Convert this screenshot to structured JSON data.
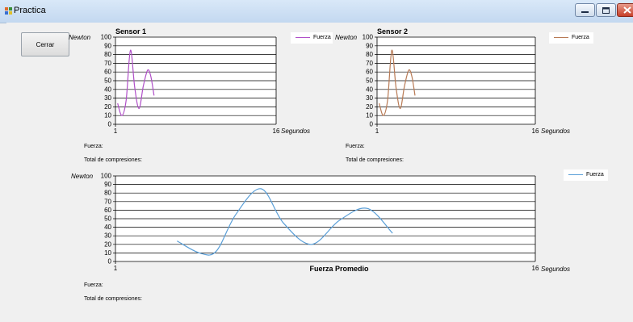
{
  "window": {
    "title": "Practica",
    "controls": {
      "minimize": "minimize-icon",
      "maximize": "maximize-icon",
      "close": "close-icon"
    }
  },
  "close_button": {
    "label": "Cerrar"
  },
  "readouts": {
    "sensor1": {
      "fuerza": "Fuerza:",
      "total": "Total de compresiones:"
    },
    "sensor2": {
      "fuerza": "Fuerza:",
      "total": "Total de compresiones:"
    },
    "promedio": {
      "fuerza": "Fuerza:",
      "total": "Total de compresiones:"
    }
  },
  "chart_data": [
    {
      "type": "line",
      "title": "Sensor 1",
      "ylabel": "Newton",
      "xlabel": "Segundos",
      "xlim": [
        1,
        16
      ],
      "ylim": [
        0,
        100
      ],
      "xticks": [
        "1",
        "16"
      ],
      "yticks": [
        "0",
        "10",
        "20",
        "30",
        "40",
        "50",
        "60",
        "70",
        "80",
        "90",
        "100"
      ],
      "grid": true,
      "legend": "top-right",
      "series": [
        {
          "name": "Fuerza",
          "color": "#b050c8",
          "x": [
            1.2,
            1.6,
            2.0,
            2.4,
            2.8,
            3.2,
            3.6,
            4.0,
            4.3,
            4.6
          ],
          "y": [
            24,
            10,
            28,
            85,
            42,
            18,
            44,
            62,
            55,
            33
          ]
        }
      ]
    },
    {
      "type": "line",
      "title": "Sensor 2",
      "ylabel": "Newton",
      "xlabel": "Segundos",
      "xlim": [
        1,
        16
      ],
      "ylim": [
        0,
        100
      ],
      "xticks": [
        "1",
        "16"
      ],
      "yticks": [
        "0",
        "10",
        "20",
        "30",
        "40",
        "50",
        "60",
        "70",
        "80",
        "90",
        "100"
      ],
      "grid": true,
      "legend": "top-right",
      "series": [
        {
          "name": "Fuerza",
          "color": "#b87a55",
          "x": [
            1.2,
            1.6,
            2.0,
            2.4,
            2.8,
            3.2,
            3.6,
            4.0,
            4.3,
            4.6
          ],
          "y": [
            24,
            10,
            28,
            85,
            42,
            18,
            44,
            62,
            55,
            33
          ]
        }
      ]
    },
    {
      "type": "line",
      "title": "Fuerza Promedio",
      "ylabel": "Newton",
      "xlabel": "Segundos",
      "xlim": [
        1,
        16
      ],
      "ylim": [
        0,
        100
      ],
      "xticks": [
        "1",
        "16"
      ],
      "yticks": [
        "0",
        "10",
        "20",
        "30",
        "40",
        "50",
        "60",
        "70",
        "80",
        "90",
        "100"
      ],
      "grid": true,
      "legend": "top-right",
      "series": [
        {
          "name": "Fuerza",
          "color": "#5a9fd8",
          "x": [
            3.2,
            4.0,
            4.6,
            5.3,
            6.2,
            7.0,
            8.0,
            9.0,
            10.0,
            10.9
          ],
          "y": [
            24,
            10,
            12,
            55,
            85,
            45,
            20,
            48,
            62,
            33
          ]
        }
      ]
    }
  ]
}
